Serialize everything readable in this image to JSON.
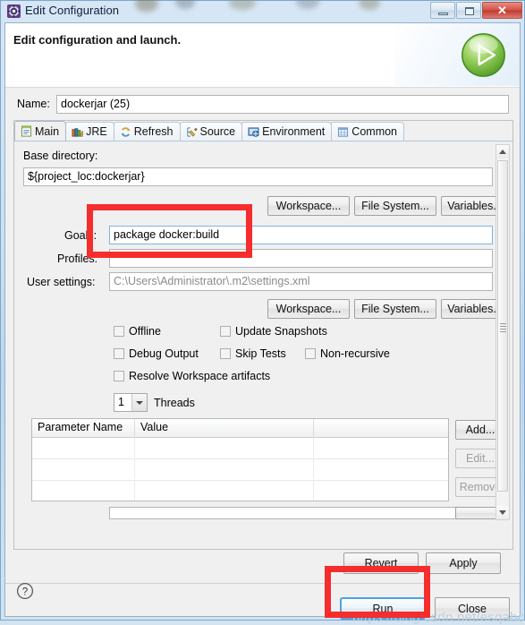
{
  "window": {
    "title": "Edit Configuration",
    "icon": "configuration-gear-icon",
    "buttons": {
      "minimize": "minimize-button",
      "maximize": "maximize-button",
      "close": "✕"
    }
  },
  "header": {
    "title": "Edit configuration and launch.",
    "run_icon": "green-play-icon"
  },
  "name_row": {
    "label": "Name:",
    "value": "dockerjar (25)"
  },
  "tabs": [
    {
      "label": "Main",
      "icon": "main-document-icon",
      "active": true
    },
    {
      "label": "JRE",
      "icon": "jre-library-icon",
      "active": false
    },
    {
      "label": "Refresh",
      "icon": "refresh-arrows-icon",
      "active": false
    },
    {
      "label": "Source",
      "icon": "source-edit-icon",
      "active": false
    },
    {
      "label": "Environment",
      "icon": "environment-icon",
      "active": false
    },
    {
      "label": "Common",
      "icon": "common-table-icon",
      "active": false
    }
  ],
  "main_tab": {
    "base_directory_label": "Base directory:",
    "base_directory_value": "${project_loc:dockerjar}",
    "browse_row_1": [
      "Workspace...",
      "File System...",
      "Variables..."
    ],
    "goals_label": "Goals:",
    "goals_value": "package docker:build",
    "profiles_label": "Profiles:",
    "profiles_value": "",
    "user_settings_label": "User settings:",
    "user_settings_value": "C:\\Users\\Administrator\\.m2\\settings.xml",
    "browse_row_2": [
      "Workspace...",
      "File System...",
      "Variables..."
    ],
    "checkboxes": [
      {
        "label": "Offline",
        "checked": false
      },
      {
        "label": "Update Snapshots",
        "checked": false
      },
      {
        "label": "Debug Output",
        "checked": false
      },
      {
        "label": "Skip Tests",
        "checked": false
      },
      {
        "label": "Non-recursive",
        "checked": false
      },
      {
        "label": "Resolve Workspace artifacts",
        "checked": false
      }
    ],
    "threads": {
      "value": "1",
      "label": "Threads"
    },
    "parameters_table": {
      "columns": [
        "Parameter Name",
        "Value"
      ],
      "rows": [
        [
          "",
          ""
        ],
        [
          "",
          ""
        ],
        [
          "",
          ""
        ]
      ]
    },
    "table_buttons": [
      {
        "label": "Add...",
        "enabled": true
      },
      {
        "label": "Edit...",
        "enabled": false
      },
      {
        "label": "Remove",
        "enabled": false
      }
    ]
  },
  "footer": {
    "revert": "Revert",
    "apply": "Apply",
    "help_icon": "help-question-icon",
    "run": "Run",
    "close": "Close"
  },
  "watermark": "https://blog.csdn.net/esqabc",
  "annotations": {
    "goals_highlight_color": "#f62d2d",
    "run_highlight_color": "#f62d2d"
  }
}
